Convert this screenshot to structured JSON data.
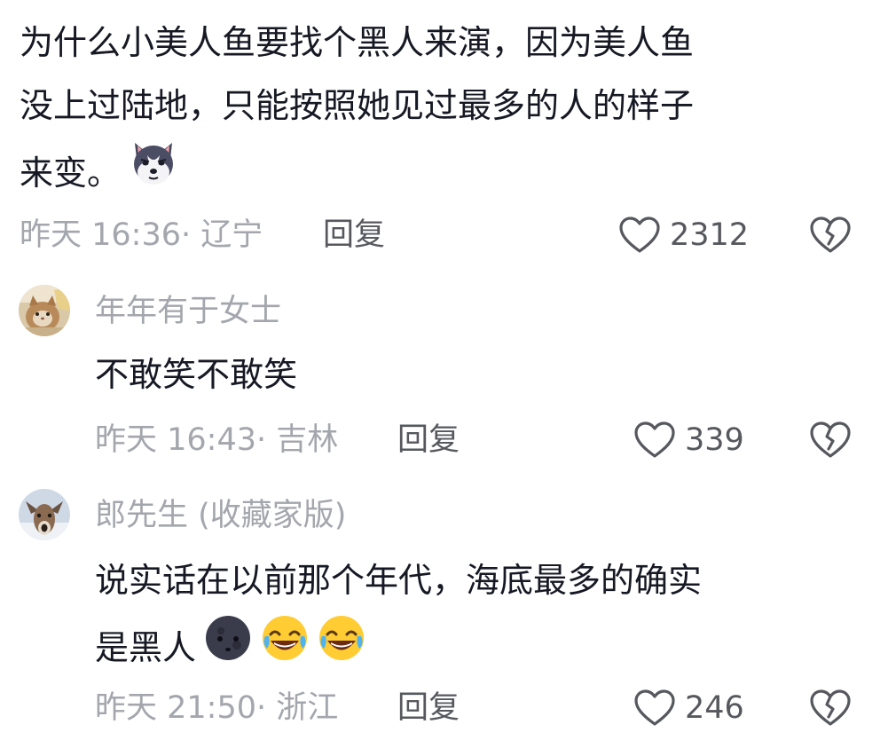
{
  "comments": [
    {
      "username": "",
      "text_lines": [
        "为什么小美人鱼要找个黑人来演，因为美人鱼",
        "没上过陆地，只能按照她见过最多的人的样子",
        "来变。"
      ],
      "emoji": [
        "husky-emoji"
      ],
      "time": "昨天 16:36",
      "location": "· 辽宁",
      "reply_label": "回复",
      "likes": "2312",
      "avatar_icon": ""
    },
    {
      "username": "年年有于女士",
      "text_lines": [
        "不敢笑不敢笑"
      ],
      "emoji": [],
      "time": "昨天 16:43",
      "location": "· 吉林",
      "reply_label": "回复",
      "likes": "339",
      "avatar_icon": "cat-avatar"
    },
    {
      "username": "郎先生 (收藏家版)",
      "text_lines": [
        "说实话在以前那个年代，海底最多的确实",
        "是黑人"
      ],
      "emoji": [
        "dark-moon-face-emoji",
        "rofl-emoji",
        "rofl-emoji"
      ],
      "time": "昨天 21:50",
      "location": "· 浙江",
      "reply_label": "回复",
      "likes": "246",
      "avatar_icon": "deer-avatar"
    }
  ],
  "colors": {
    "text": "#161823",
    "meta": "#a4a6ad",
    "action": "#57585e"
  }
}
